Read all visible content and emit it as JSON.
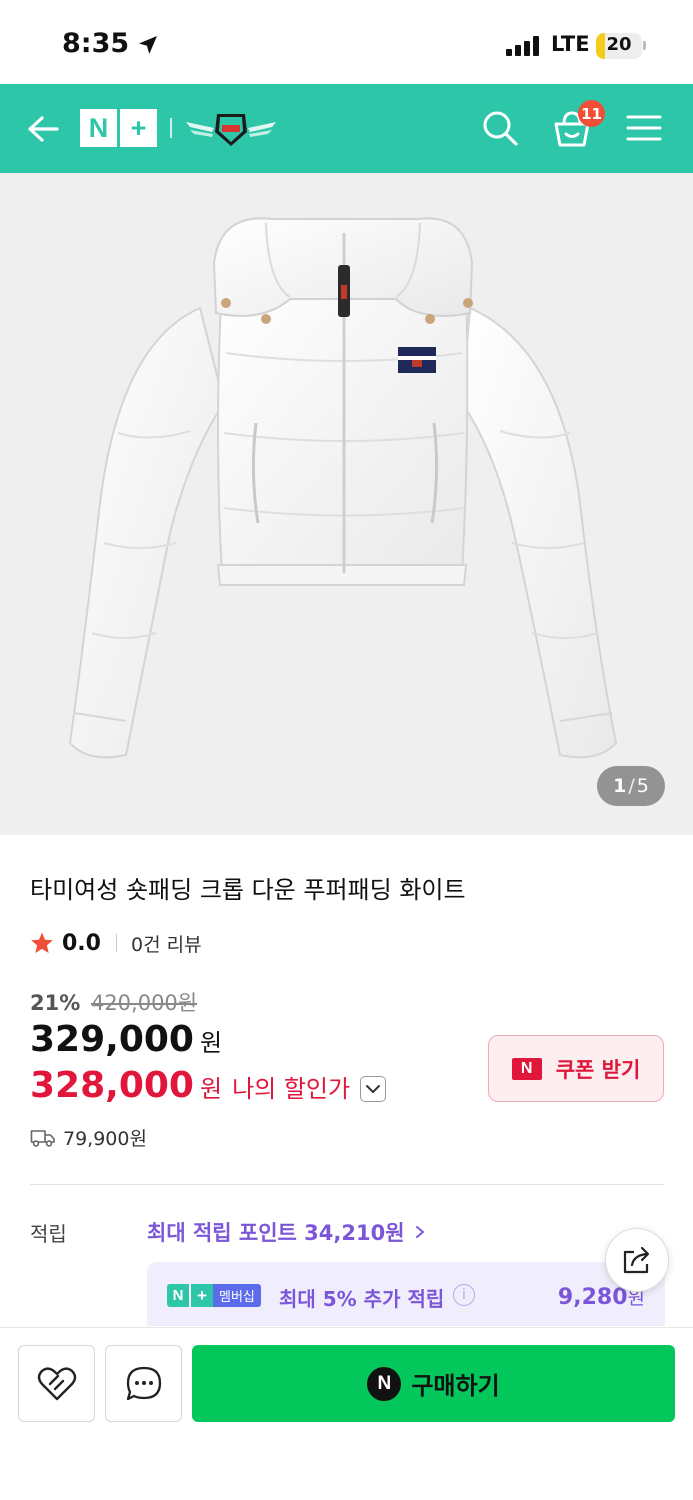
{
  "status_bar": {
    "time": "8:35",
    "network": "LTE",
    "battery": "20",
    "battery_level": 0.2
  },
  "header": {
    "logo_n": "N",
    "logo_plus": "+",
    "cart_count": "11",
    "accent_color": "#2ec6a8"
  },
  "gallery": {
    "current": "1",
    "separator": "/",
    "total": "5"
  },
  "product": {
    "title": "타미여성 숏패딩 크롭 다운 푸퍼패딩 화이트",
    "rating": "0.0",
    "review_count": "0건 리뷰",
    "discount_rate": "21%",
    "original_price": "420,000원",
    "sale_price": "329,000",
    "sale_unit": "원",
    "my_price": "328,000",
    "my_unit": "원",
    "my_price_label": "나의 할인가",
    "shipping_fee": "79,900원"
  },
  "coupon": {
    "icon_letter": "N",
    "label": "쿠폰 받기"
  },
  "points": {
    "label": "적립",
    "max_points": "최대 적립 포인트 34,210원",
    "membership_badge_n": "N",
    "membership_badge_plus": "+",
    "membership_badge_text": "멤버십",
    "membership_text": "최대 5% 추가 적립",
    "membership_amount": "9,280",
    "membership_unit": "원"
  },
  "actions": {
    "buy_icon_letter": "N",
    "buy_label": "구매하기"
  },
  "colors": {
    "brand_green": "#03c75a",
    "price_red": "#e0163a",
    "points_purple": "#7b56d9"
  }
}
